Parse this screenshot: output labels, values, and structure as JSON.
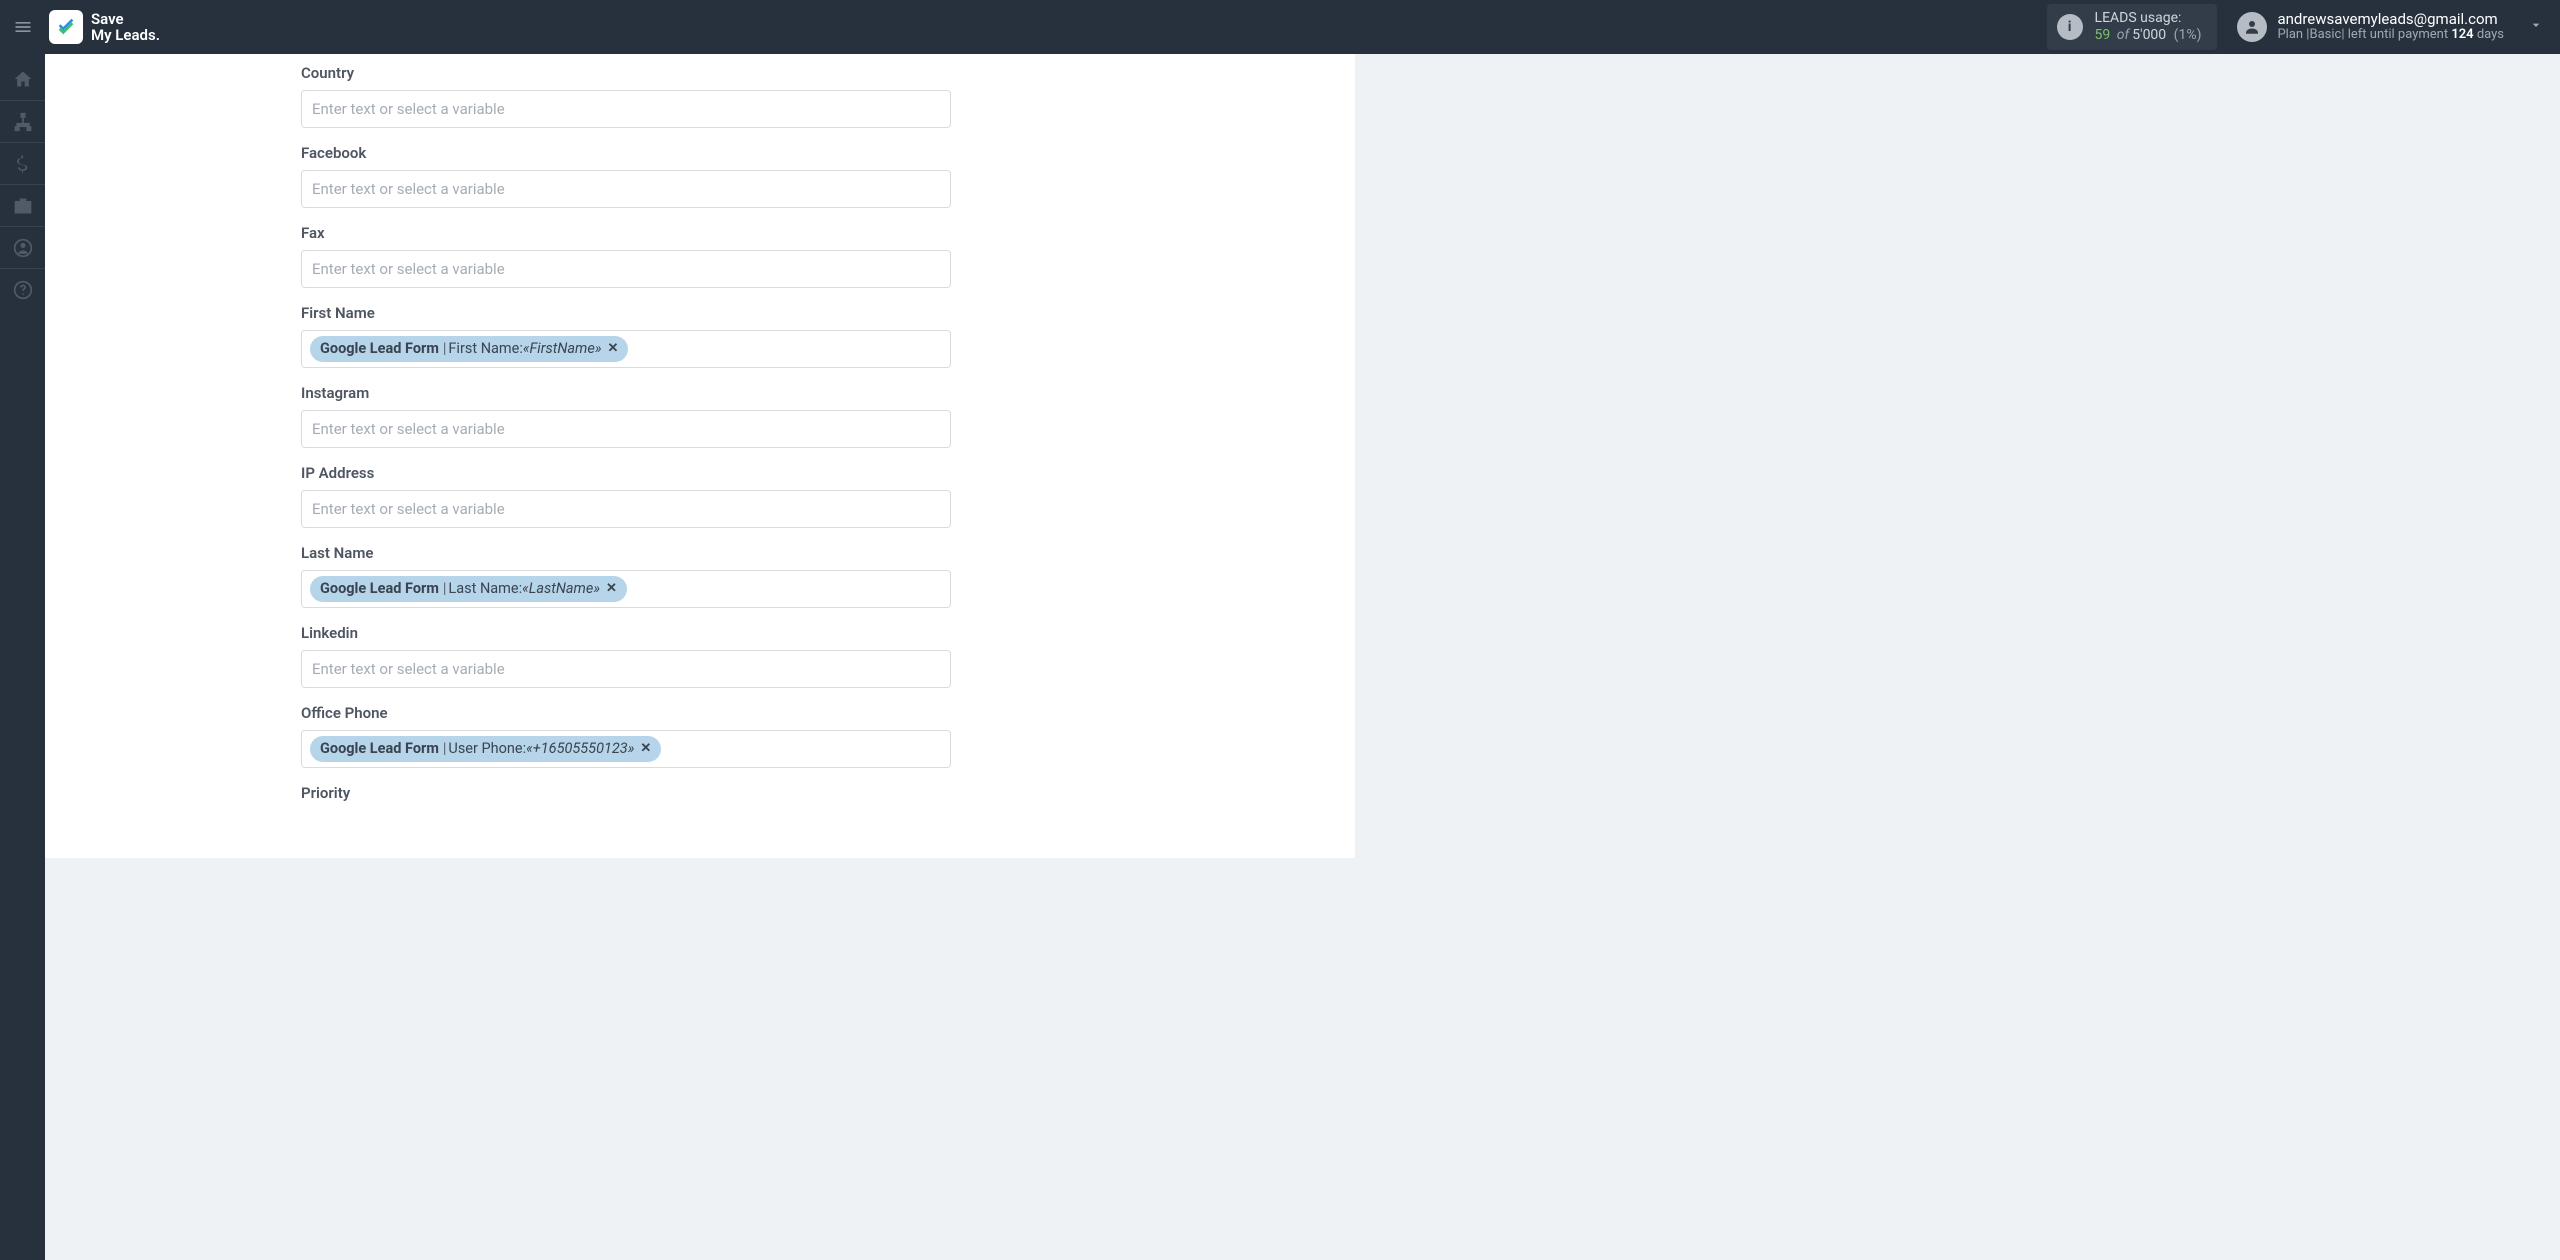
{
  "logo": {
    "line1": "Save",
    "line2": "My Leads."
  },
  "usage": {
    "label": "LEADS usage:",
    "count": "59",
    "of_word": "of",
    "total": "5'000",
    "pct": "(1%)"
  },
  "account": {
    "email": "andrewsavemyleads@gmail.com",
    "plan_prefix": "Plan |",
    "plan_name": "Basic",
    "plan_mid": "| left until payment",
    "days_num": "124",
    "days_word": "days"
  },
  "placeholder_text": "Enter text or select a variable",
  "fields": [
    {
      "id": "country",
      "label": "Country",
      "chip": null
    },
    {
      "id": "facebook",
      "label": "Facebook",
      "chip": null
    },
    {
      "id": "fax",
      "label": "Fax",
      "chip": null
    },
    {
      "id": "first_name",
      "label": "First Name",
      "chip": {
        "source": "Google Lead Form",
        "field": "First Name",
        "value": "«FirstName»"
      }
    },
    {
      "id": "instagram",
      "label": "Instagram",
      "chip": null
    },
    {
      "id": "ip_address",
      "label": "IP Address",
      "chip": null
    },
    {
      "id": "last_name",
      "label": "Last Name",
      "chip": {
        "source": "Google Lead Form",
        "field": "Last Name",
        "value": "«LastName»"
      }
    },
    {
      "id": "linkedin",
      "label": "Linkedin",
      "chip": null
    },
    {
      "id": "office_phone",
      "label": "Office Phone",
      "chip": {
        "source": "Google Lead Form",
        "field": "User Phone",
        "value": "«+16505550123»"
      }
    },
    {
      "id": "priority",
      "label": "Priority",
      "chip": null,
      "label_only": true
    }
  ]
}
